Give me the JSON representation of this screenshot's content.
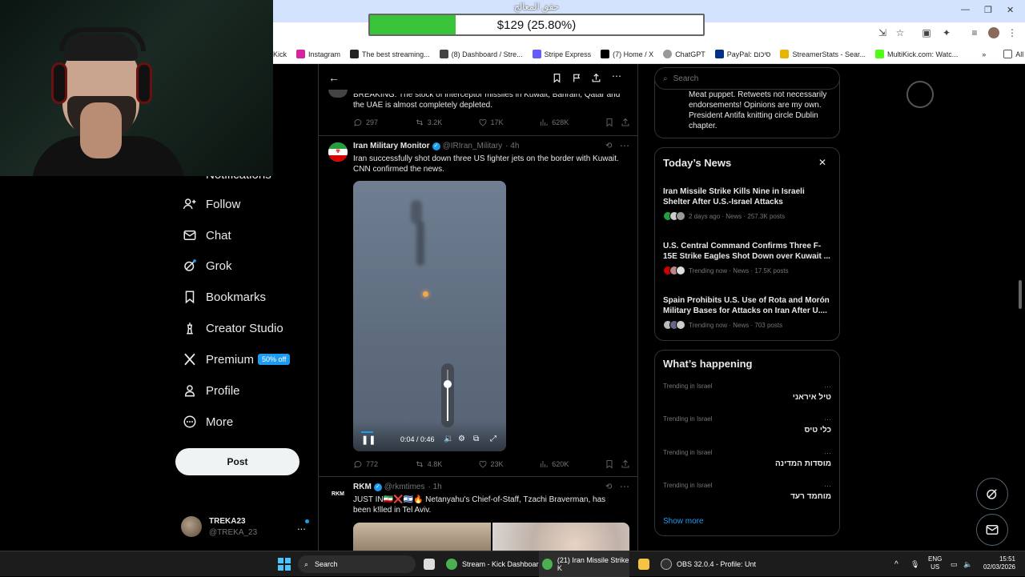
{
  "donation": {
    "label": "حقق المعالج",
    "amount_text": "$129 (25.80%)",
    "progress_percent": 25.8,
    "min": "$0",
    "max": "$500"
  },
  "bookmarks": [
    "Kick",
    "Instagram",
    "The best streaming...",
    "(8) Dashboard / Stre...",
    "Stripe Express",
    "(7) Home / X",
    "ChatGPT",
    "PayPal: סיכום",
    "StreamerStats - Sear...",
    "MultiKick.com: Watc...",
    "All Bookmarks"
  ],
  "nav": {
    "notifications": "Notifications",
    "follow": "Follow",
    "chat": "Chat",
    "grok": "Grok",
    "bookmarks": "Bookmarks",
    "creator_studio": "Creator Studio",
    "premium": "Premium",
    "premium_badge": "50% off",
    "profile": "Profile",
    "more": "More",
    "post": "Post"
  },
  "account": {
    "name": "TREKA23",
    "handle": "@TREKA_23",
    "more": "..."
  },
  "feed": {
    "tweet1": {
      "text": "BREAKING: The stock of interceptor missiles in Kuwait, Bahrain, Qatar and the UAE is almost completely depleted.",
      "replies": "297",
      "reposts": "3.2K",
      "likes": "17K",
      "views": "628K"
    },
    "tweet2": {
      "name": "Iran Military Monitor",
      "handle": "@IRIran_Military",
      "time": "· 4h",
      "text": "Iran successfully shot down three US fighter jets on the border with Kuwait. CNN confirmed the news.",
      "video_time": "0:04 / 0:46",
      "video_progress": 0.087,
      "volume": 0.72,
      "replies": "772",
      "reposts": "4.8K",
      "likes": "23K",
      "views": "620K"
    },
    "tweet3": {
      "name": "RKM",
      "handle": "@rkmtimes",
      "time": "· 1h",
      "text": "JUST IN🇮🇷❌🇮🇱🔥 Netanyahu's Chief-of-Staff, Tzachi Braverman, has been k!lled in Tel Aviv."
    }
  },
  "search": {
    "placeholder": "Search"
  },
  "bio": "Meat puppet. Retweets not necessarily endorsements! Opinions are my own. President Antifa knitting circle Dublin chapter.",
  "todays_news": {
    "title": "Today’s News",
    "items": [
      {
        "title": "Iran Missile Strike Kills Nine in Israeli Shelter After U.S.-Israel Attacks",
        "meta": "2 days ago · News · 257.3K posts"
      },
      {
        "title": "U.S. Central Command Confirms Three F-15E Strike Eagles Shot Down over Kuwait ...",
        "meta": "Trending now · News · 17.5K posts"
      },
      {
        "title": "Spain Prohibits U.S. Use of Rota and Morón Military Bases for Attacks on Iran After U....",
        "meta": "Trending now · News · 703 posts"
      }
    ]
  },
  "whats_happening": {
    "title": "What’s happening",
    "items": [
      {
        "label": "Trending in Israel",
        "name": "טיל איראני"
      },
      {
        "label": "Trending in Israel",
        "name": "כלי טיס"
      },
      {
        "label": "Trending in Israel",
        "name": "מוסדות המדינה"
      },
      {
        "label": "Trending in Israel",
        "name": "מוחמד רעד"
      }
    ],
    "show_more": "Show more"
  },
  "taskbar": {
    "search": "Search",
    "app1": "Stream - Kick Dashboar",
    "app2": "(21) Iran Missile Strike K",
    "app3": "OBS 32.0.4 - Profile: Unt",
    "lang": "ENG",
    "region": "US",
    "time": "15:51",
    "date": "02/03/2026"
  },
  "colors": {
    "accent": "#1d9bf0",
    "background": "#000000",
    "donate_fill": "#39c439"
  }
}
